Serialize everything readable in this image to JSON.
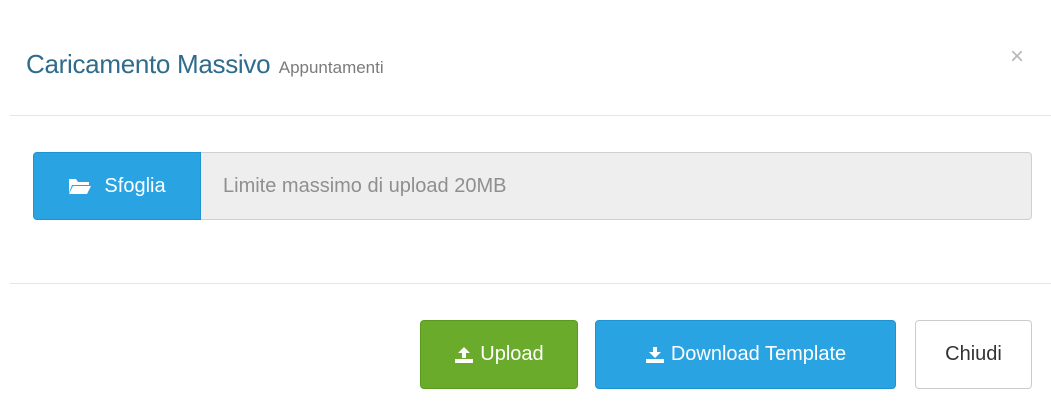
{
  "header": {
    "title": "Caricamento Massivo",
    "subtitle": "Appuntamenti",
    "close_symbol": "×"
  },
  "file_input": {
    "browse_label": "Sfoglia",
    "browse_icon": "folder-open-icon",
    "placeholder": "Limite massimo di upload 20MB"
  },
  "footer": {
    "upload_label": "Upload",
    "upload_icon": "upload-icon",
    "download_label": "Download Template",
    "download_icon": "download-icon",
    "close_label": "Chiudi"
  },
  "colors": {
    "title": "#2f6b8c",
    "primary": "#2aa3e3",
    "success": "#6aab2b"
  }
}
